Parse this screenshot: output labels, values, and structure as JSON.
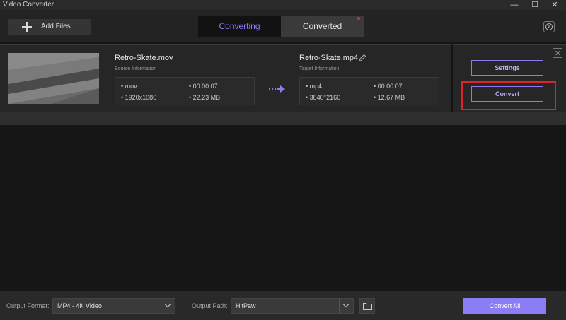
{
  "app": {
    "title": "Video Converter"
  },
  "window_controls": {
    "minimize": "—",
    "maximize": "☐",
    "close": "✕"
  },
  "toolbar": {
    "add_files_label": "Add Files",
    "tabs": [
      {
        "label": "Converting",
        "active": true
      },
      {
        "label": "Converted",
        "active": false,
        "has_notification_dot": true
      }
    ],
    "history_icon": "clock-icon"
  },
  "item": {
    "source": {
      "name": "Retro-Skate.mov",
      "info_label": "Source Information",
      "format": "• mov",
      "duration": "• 00:00:07",
      "resolution": "• 1920x1080",
      "size": "• 22.23 MB"
    },
    "target": {
      "name": "Retro-Skate.mp4",
      "info_label": "Target Information",
      "format": "• mp4",
      "duration": "• 00:00:07",
      "resolution": "• 3840*2160",
      "size": "• 12.67 MB"
    },
    "settings_label": "Settings",
    "convert_label": "Convert"
  },
  "bottom": {
    "output_format_label": "Output Format:",
    "output_format_value": "MP4 - 4K Video",
    "output_path_label": "Output Path:",
    "output_path_value": "HitPaw",
    "convert_all_label": "Convert All"
  },
  "colors": {
    "accent": "#8d7df4",
    "highlight": "#e02323",
    "background": "#161616"
  }
}
